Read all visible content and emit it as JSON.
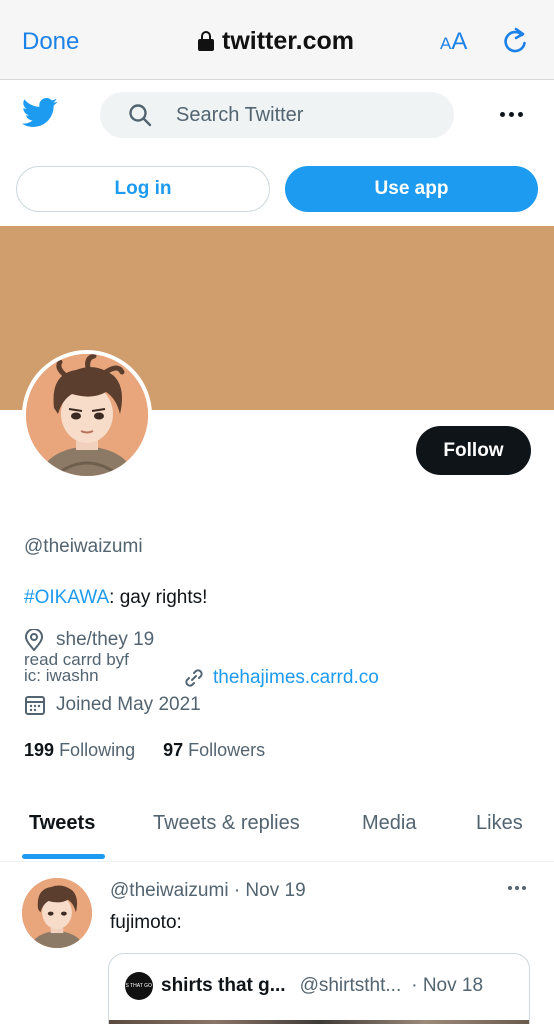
{
  "safari": {
    "done_label": "Done",
    "url": "twitter.com",
    "text_size_small": "A",
    "text_size_big": "A"
  },
  "header": {
    "search_placeholder": "Search Twitter"
  },
  "auth": {
    "login_label": "Log in",
    "use_app_label": "Use app"
  },
  "profile": {
    "banner_color": "#d09d6c",
    "follow_label": "Follow",
    "handle": "@theiwaizumi",
    "bio_hashtag": "#OIKAWA",
    "bio_text": ": gay rights!",
    "location": "she/they 19",
    "location_extra_1": "read carrd byf",
    "location_extra_2": "ic: iwashn",
    "website": "thehajimes.carrd.co",
    "joined": "Joined May 2021",
    "following_count": "199",
    "following_label": "Following",
    "followers_count": "97",
    "followers_label": "Followers"
  },
  "tabs": [
    {
      "label": "Tweets",
      "active": true
    },
    {
      "label": "Tweets & replies",
      "active": false
    },
    {
      "label": "Media",
      "active": false
    },
    {
      "label": "Likes",
      "active": false
    }
  ],
  "tweet": {
    "header": "@theiwaizumi · Nov 19",
    "text": "fujimoto:",
    "quote": {
      "avatar_text": "SHIRTS THAT GO HARD",
      "name": "shirts that g...",
      "handle": "@shirtstht...",
      "date": "· Nov 18"
    }
  },
  "colors": {
    "twitter_blue": "#1d9bf0",
    "safari_blue": "#1d82e8",
    "text_primary": "#0f1419",
    "text_secondary": "#536471"
  }
}
